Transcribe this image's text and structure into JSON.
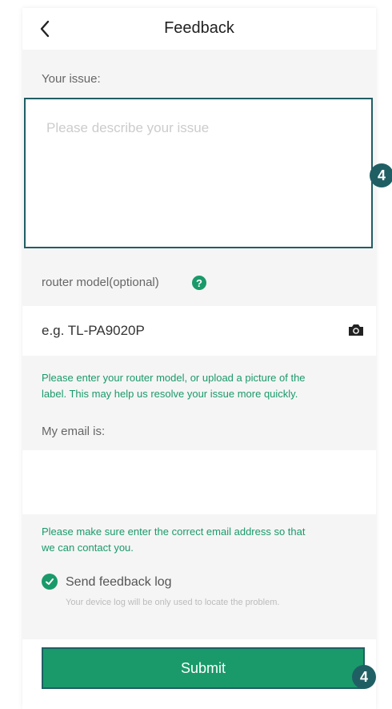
{
  "header": {
    "title": "Feedback",
    "back_icon": "chevron-left-icon"
  },
  "issue": {
    "label": "Your issue:",
    "placeholder": "Please describe your issue"
  },
  "router": {
    "label": "router model(optional)",
    "help_icon": "help-circle-icon",
    "help_glyph": "?",
    "placeholder": "e.g. TL-PA9020P",
    "camera_icon": "camera-icon",
    "hint_line1": "Please enter your router model, or upload a picture of the",
    "hint_line2": "label. This may help us resolve your issue more quickly."
  },
  "email": {
    "label": "My email is:",
    "value": "",
    "hint_line1": "Please make sure enter the correct email address so that",
    "hint_line2": "we can contact you."
  },
  "log": {
    "checked": true,
    "label": "Send feedback log",
    "sublabel": "Your device log will be only used to locate the problem."
  },
  "submit": {
    "label": "Submit"
  },
  "badges": {
    "issue_step": "4",
    "submit_step": "4"
  },
  "colors": {
    "accent": "#1a9a6a",
    "border": "#1f5f64",
    "background": "#f5f5f5"
  }
}
